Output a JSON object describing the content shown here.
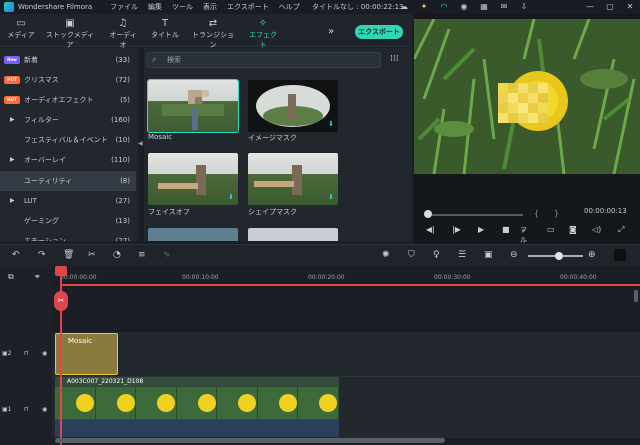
{
  "titlebar": {
    "app_name": "Wondershare Filmora",
    "menu": [
      "ファイル",
      "編集",
      "ツール",
      "表示",
      "エクスポート",
      "ヘルプ"
    ],
    "title": "タイトルなし : 00:00:22:13"
  },
  "toolbar": {
    "tabs": [
      {
        "label": "メディア",
        "icon": "folder-icon"
      },
      {
        "label": "ストックメディア",
        "icon": "stock-icon"
      },
      {
        "label": "オーディオ",
        "icon": "music-note-icon"
      },
      {
        "label": "タイトル",
        "icon": "title-t-icon"
      },
      {
        "label": "トランジション",
        "icon": "transition-icon"
      },
      {
        "label": "エフェクト",
        "icon": "effects-icon"
      }
    ],
    "active_tab": "エフェクト",
    "export_label": "エクスポート"
  },
  "categories": [
    {
      "label": "新着",
      "count": "(33)",
      "badge": "New"
    },
    {
      "label": "クリスマス",
      "count": "(72)",
      "badge": "HOT"
    },
    {
      "label": "オーディオエフェクト",
      "count": "(5)",
      "badge": "HOT"
    },
    {
      "label": "フィルター",
      "count": "(160)",
      "arrow": true
    },
    {
      "label": "フェスティバル＆イベント",
      "count": "(10)"
    },
    {
      "label": "オーバーレイ",
      "count": "(110)",
      "arrow": true
    },
    {
      "label": "ユーティリティ",
      "count": "(8)",
      "selected": true
    },
    {
      "label": "LUT",
      "count": "(27)",
      "arrow": true
    },
    {
      "label": "ゲーミング",
      "count": "(13)"
    },
    {
      "label": "エモーション",
      "count": "(27)"
    }
  ],
  "search": {
    "placeholder": "検索"
  },
  "effects": [
    {
      "label": "Mosaic",
      "selected": true
    },
    {
      "label": "イメージマスク"
    },
    {
      "label": "フェイスオフ"
    },
    {
      "label": "シェイプマスク"
    }
  ],
  "preview": {
    "timecode": "00:00:00:13",
    "progress": 0.02,
    "quality_label": "フル"
  },
  "timeline": {
    "ruler": [
      "00:00:00:00",
      "00:00:10:00",
      "00:00:20:00",
      "00:00:30:00",
      "00:00:40:00"
    ],
    "tracks": [
      {
        "number": "2",
        "clip": "Mosaic"
      },
      {
        "number": "1",
        "clip": "A003C007_220321_D108"
      }
    ]
  },
  "colors": {
    "accent": "#2fe0c0",
    "playhead": "#e0454a",
    "mosaic_clip": "#8a7a3c"
  }
}
